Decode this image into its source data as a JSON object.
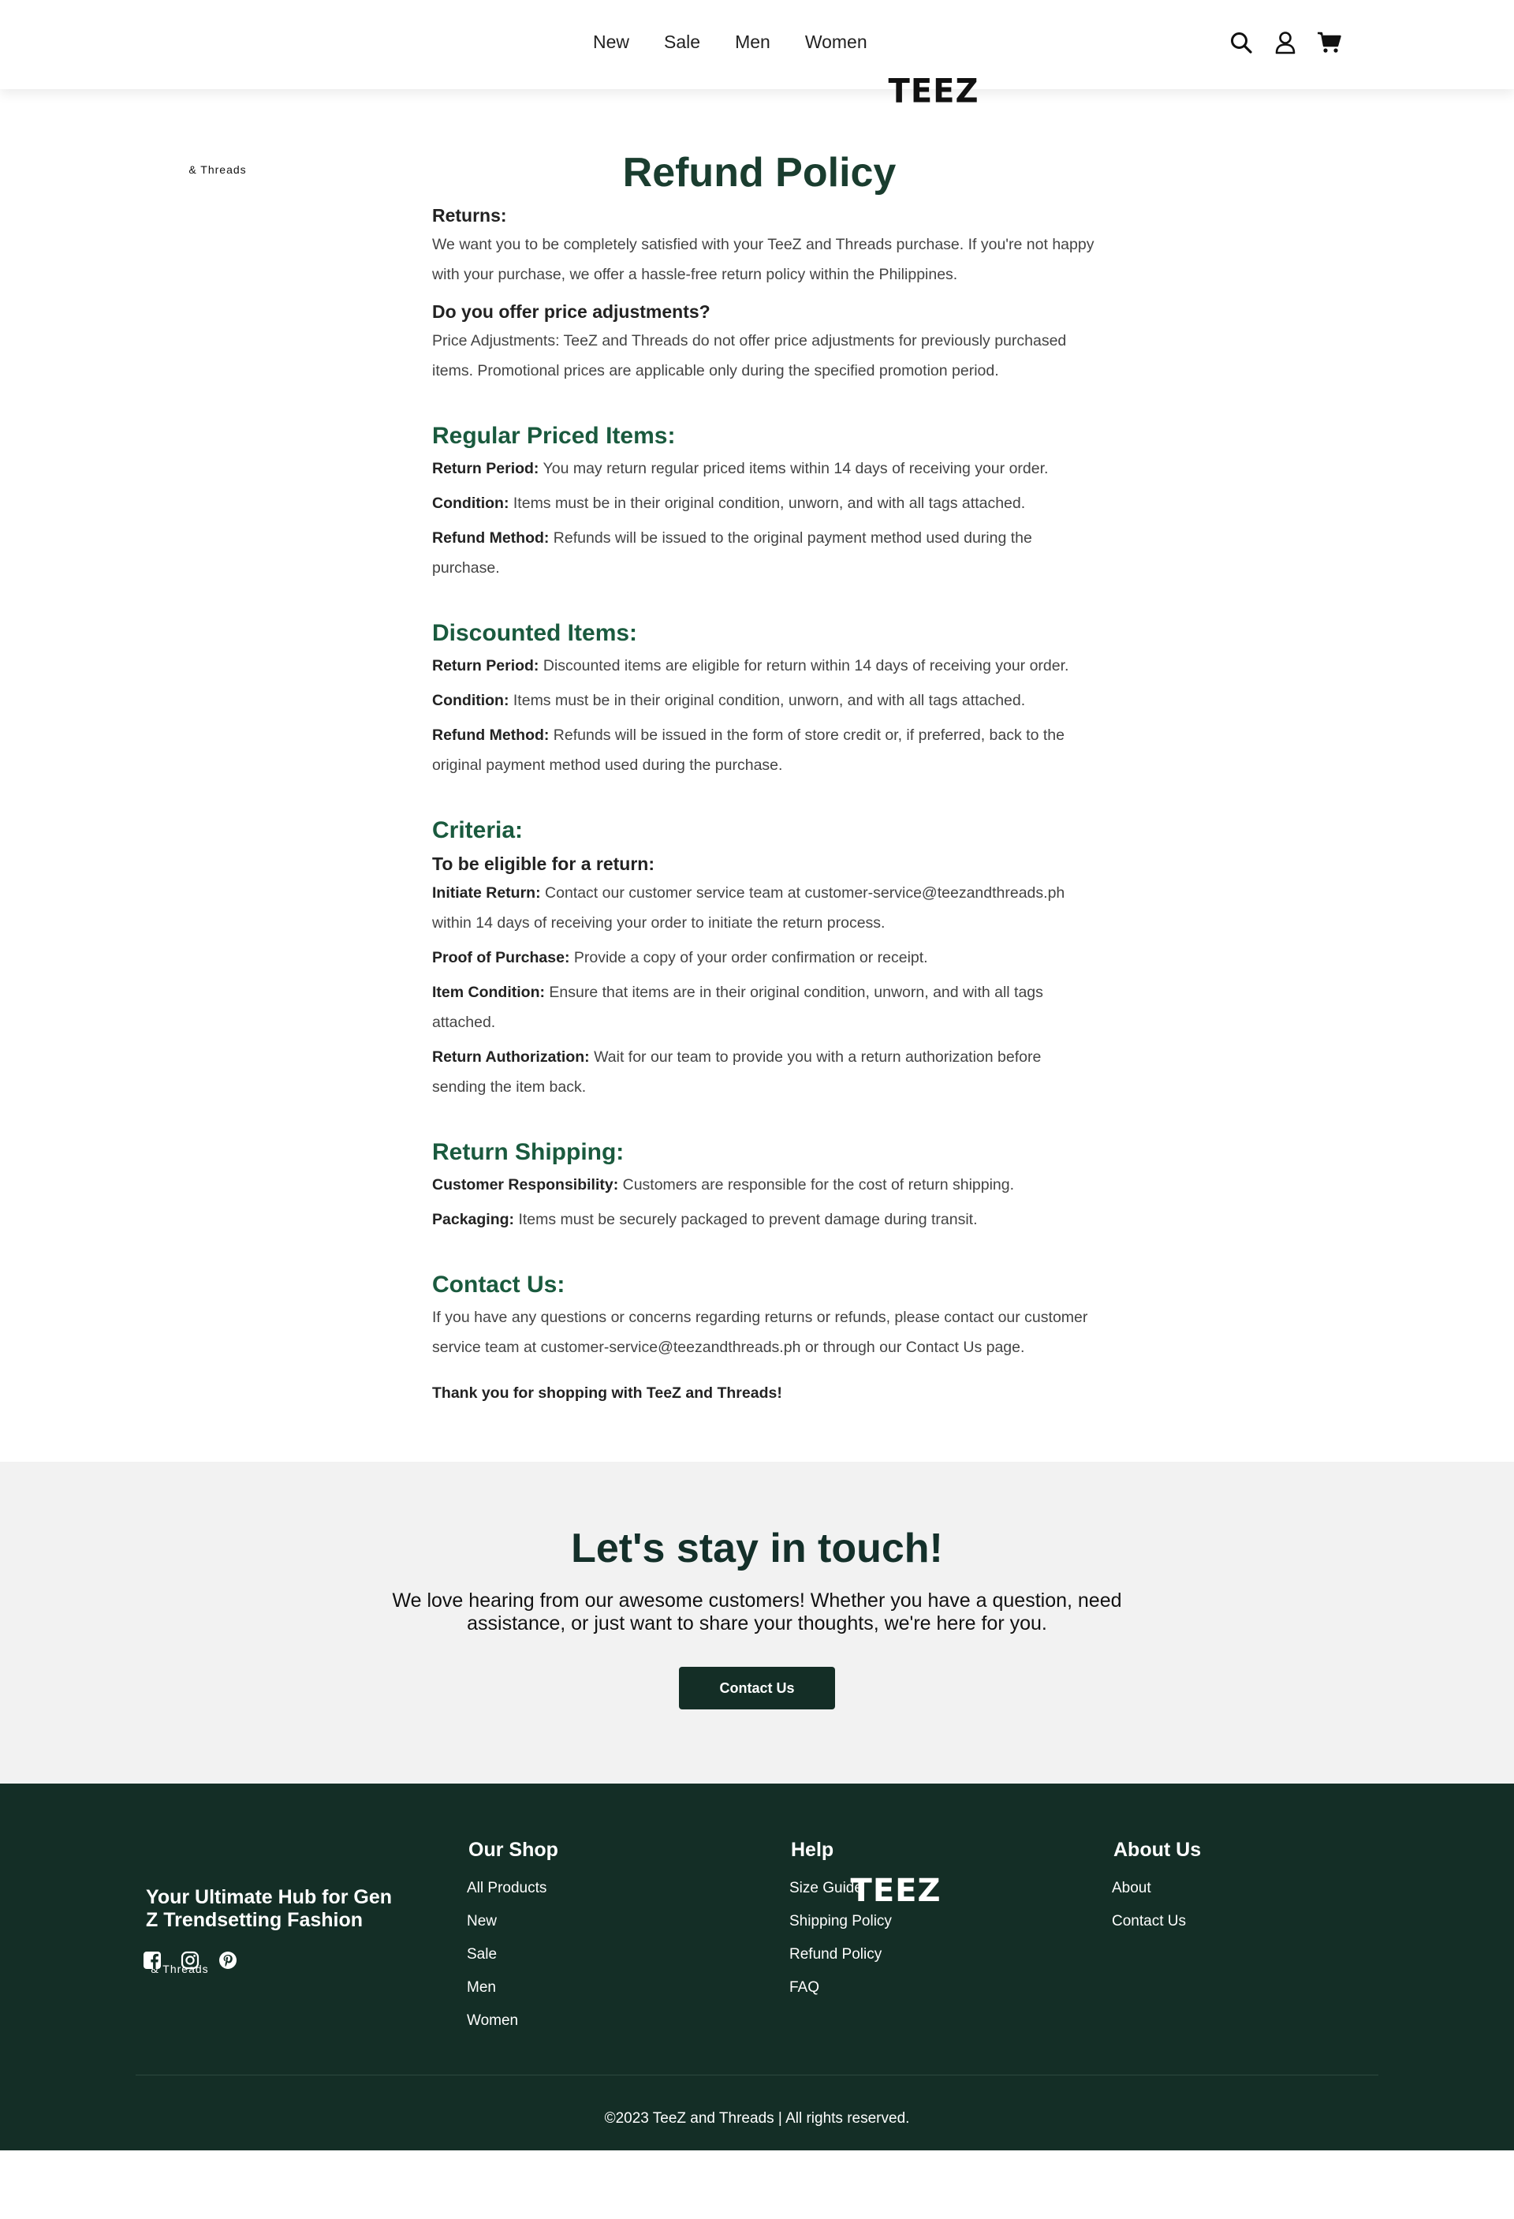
{
  "header": {
    "logo_main": "TEEZ",
    "logo_sub": "& Threads",
    "nav": [
      "New",
      "Sale",
      "Men",
      "Women"
    ],
    "icons": [
      "search-icon",
      "user-icon",
      "cart-icon"
    ]
  },
  "policy": {
    "title": "Refund Policy",
    "returns_heading": "Returns:",
    "returns_text": "We want you to be completely satisfied with your TeeZ and Threads purchase. If you're not happy with your purchase, we offer a hassle-free return policy within the Philippines.",
    "price_heading": "Do you offer price adjustments?",
    "price_text": "Price Adjustments: TeeZ and Threads do not offer price adjustments for previously purchased items. Promotional prices are applicable only during the specified promotion period.",
    "regular": {
      "heading": "Regular Priced Items:",
      "items": [
        {
          "label": "Return Period:",
          "text": " You may return regular priced items within 14 days of receiving your order."
        },
        {
          "label": "Condition:",
          "text": " Items must be in their original condition, unworn, and with all tags attached."
        },
        {
          "label": "Refund Method:",
          "text": " Refunds will be issued to the original payment method used during the purchase."
        }
      ]
    },
    "discounted": {
      "heading": "Discounted Items:",
      "items": [
        {
          "label": "Return Period:",
          "text": " Discounted items are eligible for return within 14 days of receiving your order."
        },
        {
          "label": "Condition:",
          "text": " Items must be in their original condition, unworn, and with all tags attached."
        },
        {
          "label": "Refund Method:",
          "text": " Refunds will be issued in the form of store credit or, if preferred, back to the original payment method used during the purchase."
        }
      ]
    },
    "criteria": {
      "heading": "Criteria:",
      "subheading": "To be eligible for a return:",
      "items": [
        {
          "label": "Initiate Return:",
          "text": " Contact our customer service team at customer-service@teezandthreads.ph within 14 days of receiving your order to initiate the return process."
        },
        {
          "label": "Proof of Purchase:",
          "text": " Provide a copy of your order confirmation or receipt."
        },
        {
          "label": "Item Condition:",
          "text": " Ensure that items are in their original condition, unworn, and with all tags attached."
        },
        {
          "label": "Return Authorization:",
          "text": " Wait for our team to provide you with a return authorization before sending the item back."
        }
      ]
    },
    "shipping": {
      "heading": "Return Shipping:",
      "items": [
        {
          "label": "Customer Responsibility:",
          "text": " Customers are responsible for the cost of return shipping."
        },
        {
          "label": "Packaging:",
          "text": " Items must be securely packaged to prevent damage during transit."
        }
      ]
    },
    "contact": {
      "heading": "Contact Us:",
      "text": "If you have any questions or concerns regarding returns or refunds, please contact our customer service team at customer-service@teezandthreads.ph or through our Contact Us page."
    },
    "thanks": "Thank you for shopping with TeeZ and Threads!"
  },
  "touch": {
    "heading": "Let's stay in touch!",
    "text": "We love hearing from our awesome customers! Whether you have a question, need assistance, or just want to share your thoughts, we're here for you.",
    "button": "Contact Us"
  },
  "footer": {
    "logo_main": "TEEZ",
    "logo_sub": "& Threads",
    "tagline": "Your Ultimate Hub for Gen Z Trendsetting Fashion",
    "social": [
      "facebook-icon",
      "instagram-icon",
      "pinterest-icon"
    ],
    "shop": {
      "heading": "Our Shop",
      "links": [
        "All Products",
        "New",
        "Sale",
        "Men",
        "Women"
      ]
    },
    "help": {
      "heading": "Help",
      "links": [
        "Size Guide",
        "Shipping Policy",
        "Refund Policy",
        "FAQ"
      ]
    },
    "about": {
      "heading": "About Us",
      "links": [
        "About",
        "Contact Us"
      ]
    },
    "copyright": "©2023 TeeZ and Threads | All rights reserved."
  },
  "colors": {
    "brand_dark": "#142e26",
    "heading_green": "#1a5a3e",
    "title_green": "#1a3d2f",
    "touch_bg": "#f2f2f2"
  }
}
